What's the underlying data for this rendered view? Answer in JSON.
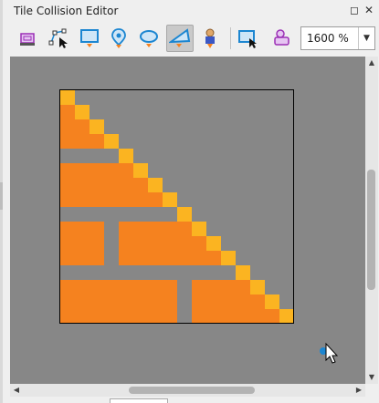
{
  "window": {
    "title": "Tile Collision Editor",
    "float_glyph": "◻",
    "close_glyph": "✕"
  },
  "toolbar": {
    "tools": [
      {
        "name": "select-objects-tool-icon"
      },
      {
        "name": "edit-polygons-tool-icon"
      },
      {
        "name": "insert-rectangle-tool-icon"
      },
      {
        "name": "insert-point-tool-icon"
      },
      {
        "name": "insert-ellipse-tool-icon"
      },
      {
        "name": "insert-polygon-tool-icon",
        "active": true
      },
      {
        "name": "insert-template-tool-icon"
      },
      {
        "name": "insert-text-tool-icon"
      },
      {
        "name": "layer-properties-icon"
      }
    ],
    "zoom_value": "1600 %",
    "zoom_drop_glyph": "▼"
  },
  "scrollbars": {
    "up": "▲",
    "down": "▼",
    "left": "◀",
    "right": "▶"
  },
  "colors": {
    "canvas_bg": "#878787",
    "fill_orange": "#f5821f",
    "fill_yellow": "#fbb421",
    "tile_border": "#000000",
    "accent_purple": "#9b2fb5",
    "accent_blue": "#1c86d1"
  }
}
